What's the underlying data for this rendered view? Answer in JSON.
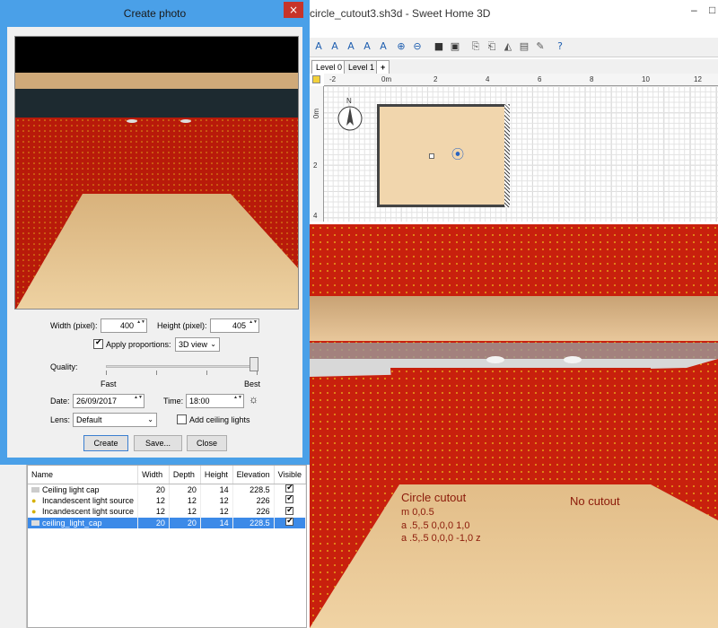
{
  "app": {
    "window_title": "circle_cutout3.sh3d - Sweet Home 3D",
    "controls": {
      "minimize": "–",
      "maximize": "□"
    }
  },
  "toolbar": {
    "icons": [
      "add-text-icon",
      "text-style-icon",
      "increase-text-icon",
      "decrease-text-icon",
      "italic-text-icon",
      "zoom-in-icon",
      "zoom-out-icon",
      "camera-icon",
      "photo-icon",
      "import-furniture-icon",
      "import-texture-icon",
      "room-icon",
      "export-icon",
      "wizard-icon",
      "help-icon"
    ]
  },
  "levels": {
    "tabs": [
      "Level 0",
      "Level 1"
    ],
    "add": "+"
  },
  "plan": {
    "h_ticks": [
      "-2",
      "0m",
      "2",
      "4",
      "6",
      "8",
      "10",
      "12"
    ],
    "v_ticks": [
      "0m",
      "2",
      "4"
    ],
    "compass_label": "N"
  },
  "view3d": {
    "left_label": "Circle cutout",
    "code_lines": [
      "m 0,0.5",
      "a .5,.5 0,0,0 1,0",
      "a .5,.5 0,0,0 -1,0 z"
    ],
    "right_label": "No cutout"
  },
  "furniture": {
    "columns": [
      "Name",
      "Width",
      "Depth",
      "Height",
      "Elevation",
      "Visible"
    ],
    "rows": [
      {
        "name": "Ceiling light cap",
        "width": "20",
        "depth": "20",
        "height": "14",
        "elevation": "228.5",
        "visible": true,
        "selected": false
      },
      {
        "name": "Incandescent light source",
        "width": "12",
        "depth": "12",
        "height": "12",
        "elevation": "226",
        "visible": true,
        "selected": false
      },
      {
        "name": "Incandescent light source",
        "width": "12",
        "depth": "12",
        "height": "12",
        "elevation": "226",
        "visible": true,
        "selected": false
      },
      {
        "name": "ceiling_light_cap",
        "width": "20",
        "depth": "20",
        "height": "14",
        "elevation": "228.5",
        "visible": true,
        "selected": true
      }
    ]
  },
  "dialog": {
    "title": "Create photo",
    "close": "×",
    "width_label": "Width (pixel):",
    "width_value": "400",
    "height_label": "Height (pixel):",
    "height_value": "405",
    "apply_proportions_label": "Apply proportions:",
    "proportions_value": "3D view",
    "quality_label": "Quality:",
    "quality_fast": "Fast",
    "quality_best": "Best",
    "quality_level": 1.0,
    "date_label": "Date:",
    "date_value": "26/09/2017",
    "time_label": "Time:",
    "time_value": "18:00",
    "lens_label": "Lens:",
    "lens_value": "Default",
    "ceiling_lights_label": "Add ceiling lights",
    "buttons": {
      "create": "Create",
      "save": "Save...",
      "close": "Close"
    }
  },
  "colors": {
    "accent": "#4aa0e8",
    "wall": "#c8200d",
    "floor": "#e8c48e",
    "selection": "#3c8ae8"
  }
}
